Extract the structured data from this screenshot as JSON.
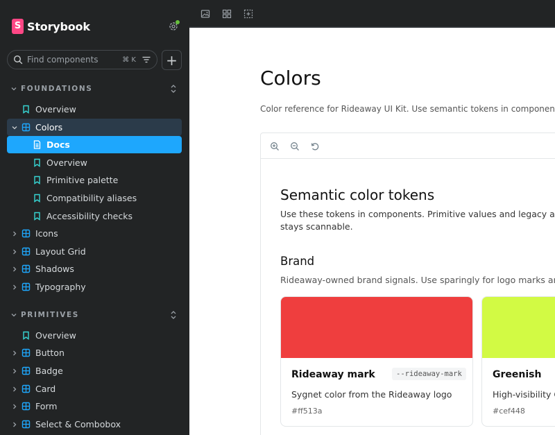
{
  "app": {
    "brand": "Storybook"
  },
  "search": {
    "placeholder": "Find components",
    "shortcut": "⌘ K"
  },
  "sidebar": {
    "foundations": {
      "title": "FOUNDATIONS",
      "items": [
        {
          "label": "Overview",
          "icon": "bookmark-icon"
        },
        {
          "label": "Colors",
          "icon": "component-icon"
        },
        {
          "label": "Docs",
          "icon": "document-icon"
        },
        {
          "label": "Overview",
          "icon": "bookmark-icon"
        },
        {
          "label": "Primitive palette",
          "icon": "bookmark-icon"
        },
        {
          "label": "Compatibility aliases",
          "icon": "bookmark-icon"
        },
        {
          "label": "Accessibility checks",
          "icon": "bookmark-icon"
        },
        {
          "label": "Icons",
          "icon": "component-icon"
        },
        {
          "label": "Layout Grid",
          "icon": "component-icon"
        },
        {
          "label": "Shadows",
          "icon": "component-icon"
        },
        {
          "label": "Typography",
          "icon": "component-icon"
        }
      ]
    },
    "primitives": {
      "title": "PRIMITIVES",
      "items": [
        {
          "label": "Overview",
          "icon": "bookmark-icon"
        },
        {
          "label": "Button",
          "icon": "component-icon"
        },
        {
          "label": "Badge",
          "icon": "component-icon"
        },
        {
          "label": "Card",
          "icon": "component-icon"
        },
        {
          "label": "Form",
          "icon": "component-icon"
        },
        {
          "label": "Select & Combobox",
          "icon": "component-icon"
        }
      ]
    }
  },
  "page": {
    "title": "Colors",
    "description": "Color reference for Rideaway UI Kit. Use semantic tokens in components; p"
  },
  "canvas": {
    "section_title": "Semantic color tokens",
    "section_desc_1": "Use these tokens in components. Primitive values and legacy alias",
    "section_desc_2": "stays scannable.",
    "group_title": "Brand",
    "group_desc": "Rideaway-owned brand signals. Use sparingly for logo marks and",
    "cards": [
      {
        "name": "Rideaway mark",
        "token": "--rideaway-mark",
        "description": "Sygnet color from the Rideaway logo",
        "hex": "#ff513a",
        "color": "#ef3e3e"
      },
      {
        "name": "Greenish",
        "token": "",
        "description": "High-visibility C",
        "hex": "#cef448",
        "color": "#d2fa44"
      }
    ]
  },
  "colors": {
    "sidebar_bg": "#222425",
    "accent": "#1ea7fd",
    "storybook_pink": "#ff4785",
    "status_dot": "#66bf3c"
  }
}
